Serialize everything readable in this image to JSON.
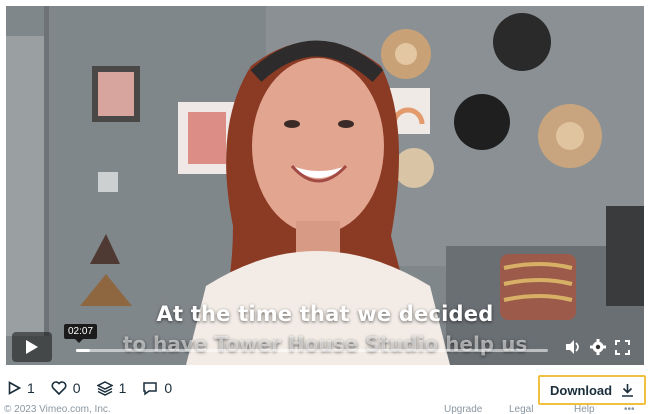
{
  "video": {
    "caption_line1": "At the time that we decided",
    "caption_line2": "to have Tower House Studio help us",
    "time_tooltip": "02:07",
    "progress_fraction": 0.03
  },
  "stats": {
    "plays": "1",
    "likes": "0",
    "collections": "1",
    "comments": "0"
  },
  "download_label": "Download",
  "footer": {
    "copyright": "© 2023 Vimeo.com, Inc.",
    "links": [
      "Upgrade",
      "Legal",
      "Help"
    ]
  },
  "icons": {
    "play": "play-icon",
    "volume": "volume-icon",
    "settings": "gear-icon",
    "fullscreen": "fullscreen-icon",
    "heart": "heart-icon",
    "layers": "layers-icon",
    "comment": "comment-icon",
    "download": "download-arrow-icon"
  },
  "colors": {
    "download_border": "#f0c040",
    "text": "#1a2e3b"
  }
}
